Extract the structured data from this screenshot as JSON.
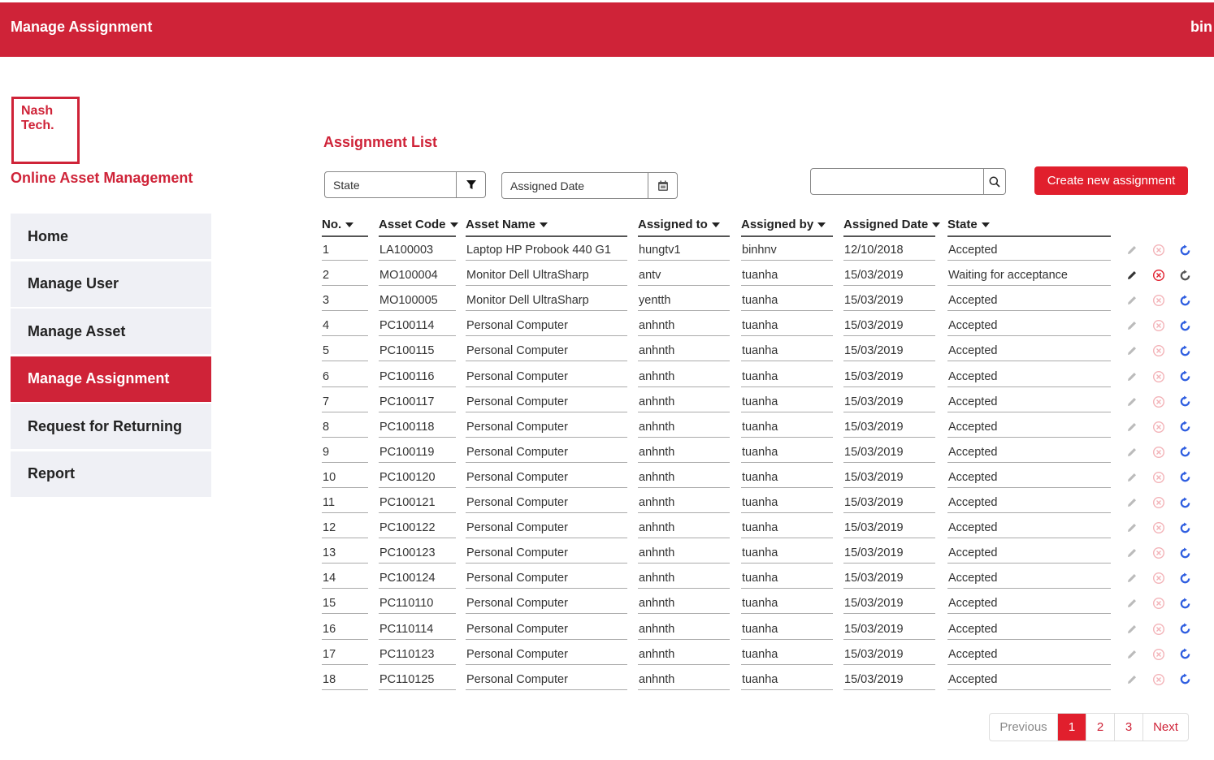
{
  "topbar": {
    "title": "Manage Assignment",
    "user": "bin"
  },
  "logo": {
    "line1": "Nash",
    "line2": "Tech."
  },
  "app_name": "Online Asset Management",
  "nav": [
    {
      "label": "Home",
      "active": false
    },
    {
      "label": "Manage User",
      "active": false
    },
    {
      "label": "Manage Asset",
      "active": false
    },
    {
      "label": "Manage Assignment",
      "active": true
    },
    {
      "label": "Request for Returning",
      "active": false
    },
    {
      "label": "Report",
      "active": false
    }
  ],
  "list_title": "Assignment List",
  "filters": {
    "state": "State",
    "assigned_date": "Assigned Date"
  },
  "search": {
    "value": "",
    "placeholder": ""
  },
  "create_button": "Create new assignment",
  "columns": [
    "No.",
    "Asset Code",
    "Asset Name",
    "Assigned to",
    "Assigned by",
    "Assigned Date",
    "State"
  ],
  "rows": [
    {
      "no": "1",
      "code": "LA100003",
      "name": "Laptop HP Probook 440 G1",
      "to": "hungtv1",
      "by": "binhnv",
      "date": "12/10/2018",
      "state": "Accepted",
      "editable": false
    },
    {
      "no": "2",
      "code": "MO100004",
      "name": "Monitor Dell UltraSharp",
      "to": "antv",
      "by": "tuanha",
      "date": "15/03/2019",
      "state": "Waiting for acceptance",
      "editable": true
    },
    {
      "no": "3",
      "code": "MO100005",
      "name": "Monitor Dell UltraSharp",
      "to": "yentth",
      "by": "tuanha",
      "date": "15/03/2019",
      "state": "Accepted",
      "editable": false
    },
    {
      "no": "4",
      "code": "PC100114",
      "name": "Personal Computer",
      "to": "anhnth",
      "by": "tuanha",
      "date": "15/03/2019",
      "state": "Accepted",
      "editable": false
    },
    {
      "no": "5",
      "code": "PC100115",
      "name": "Personal Computer",
      "to": "anhnth",
      "by": "tuanha",
      "date": "15/03/2019",
      "state": "Accepted",
      "editable": false
    },
    {
      "no": "6",
      "code": "PC100116",
      "name": "Personal Computer",
      "to": "anhnth",
      "by": "tuanha",
      "date": "15/03/2019",
      "state": "Accepted",
      "editable": false
    },
    {
      "no": "7",
      "code": "PC100117",
      "name": "Personal Computer",
      "to": "anhnth",
      "by": "tuanha",
      "date": "15/03/2019",
      "state": "Accepted",
      "editable": false
    },
    {
      "no": "8",
      "code": "PC100118",
      "name": "Personal Computer",
      "to": "anhnth",
      "by": "tuanha",
      "date": "15/03/2019",
      "state": "Accepted",
      "editable": false
    },
    {
      "no": "9",
      "code": "PC100119",
      "name": "Personal Computer",
      "to": "anhnth",
      "by": "tuanha",
      "date": "15/03/2019",
      "state": "Accepted",
      "editable": false
    },
    {
      "no": "10",
      "code": "PC100120",
      "name": "Personal Computer",
      "to": "anhnth",
      "by": "tuanha",
      "date": "15/03/2019",
      "state": "Accepted",
      "editable": false
    },
    {
      "no": "11",
      "code": "PC100121",
      "name": "Personal Computer",
      "to": "anhnth",
      "by": "tuanha",
      "date": "15/03/2019",
      "state": "Accepted",
      "editable": false
    },
    {
      "no": "12",
      "code": "PC100122",
      "name": "Personal Computer",
      "to": "anhnth",
      "by": "tuanha",
      "date": "15/03/2019",
      "state": "Accepted",
      "editable": false
    },
    {
      "no": "13",
      "code": "PC100123",
      "name": "Personal Computer",
      "to": "anhnth",
      "by": "tuanha",
      "date": "15/03/2019",
      "state": "Accepted",
      "editable": false
    },
    {
      "no": "14",
      "code": "PC100124",
      "name": "Personal Computer",
      "to": "anhnth",
      "by": "tuanha",
      "date": "15/03/2019",
      "state": "Accepted",
      "editable": false
    },
    {
      "no": "15",
      "code": "PC110110",
      "name": "Personal Computer",
      "to": "anhnth",
      "by": "tuanha",
      "date": "15/03/2019",
      "state": "Accepted",
      "editable": false
    },
    {
      "no": "16",
      "code": "PC110114",
      "name": "Personal Computer",
      "to": "anhnth",
      "by": "tuanha",
      "date": "15/03/2019",
      "state": "Accepted",
      "editable": false
    },
    {
      "no": "17",
      "code": "PC110123",
      "name": "Personal Computer",
      "to": "anhnth",
      "by": "tuanha",
      "date": "15/03/2019",
      "state": "Accepted",
      "editable": false
    },
    {
      "no": "18",
      "code": "PC110125",
      "name": "Personal Computer",
      "to": "anhnth",
      "by": "tuanha",
      "date": "15/03/2019",
      "state": "Accepted",
      "editable": false
    }
  ],
  "pagination": {
    "previous": "Previous",
    "pages": [
      "1",
      "2",
      "3"
    ],
    "current": "1",
    "next": "Next"
  },
  "colors": {
    "brand": "#cf2338",
    "button": "#e11f2d",
    "return_icon": "#2f5ee0"
  }
}
